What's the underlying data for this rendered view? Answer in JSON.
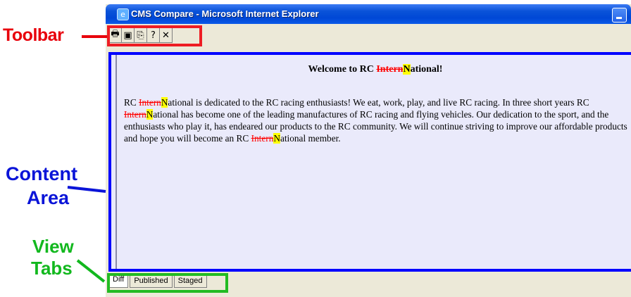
{
  "window": {
    "title": "CMS Compare - Microsoft Internet Explorer"
  },
  "callouts": {
    "toolbar": "Toolbar",
    "content_line1": "Content",
    "content_line2": "Area",
    "tabs_line1": "View",
    "tabs_line2": "Tabs"
  },
  "toolbar": {
    "buttons": [
      {
        "name": "print",
        "icon": "printer-icon",
        "glyph": "🖶"
      },
      {
        "name": "save",
        "icon": "floppy-disk-icon",
        "glyph": "▣"
      },
      {
        "name": "properties",
        "icon": "properties-icon",
        "glyph": "⎘"
      },
      {
        "name": "help",
        "icon": "help-icon",
        "glyph": "?"
      },
      {
        "name": "close",
        "icon": "close-icon",
        "glyph": "✕"
      }
    ]
  },
  "content": {
    "heading_prefix": "Welcome to RC ",
    "deleted": "Intern",
    "inserted": "N",
    "heading_suffix": "ational!",
    "para_seg1": "RC ",
    "para_seg2": "ational is dedicated to the RC racing enthusiasts! We eat, work, play, and live RC racing. In three short years RC ",
    "para_seg3": "ational has become one of the leading manufactures of RC racing and flying vehicles. Our dedication to the sport, and the enthusiasts who play it, has endeared our products to the RC community. We will continue striving to improve our affordable products and hope you will become an RC ",
    "para_seg4": "ational member."
  },
  "tabs": [
    {
      "label": "Diff",
      "active": true
    },
    {
      "label": "Published",
      "active": false
    },
    {
      "label": "Staged",
      "active": false
    }
  ],
  "colors": {
    "toolbar_callout": "#e8000b",
    "content_callout": "#0a14d8",
    "tabs_callout": "#12b81e",
    "deleted_text": "#ff0000",
    "inserted_highlight": "#ffff00"
  }
}
